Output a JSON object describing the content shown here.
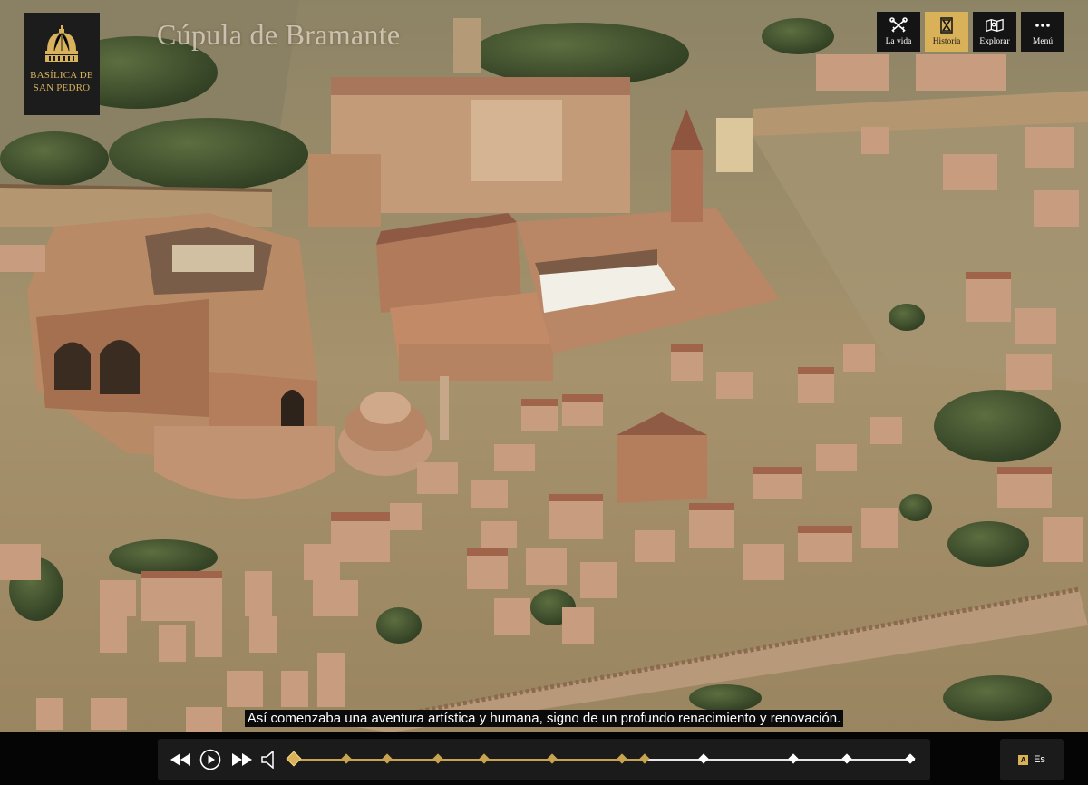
{
  "logo": {
    "line1": "BASÍLICA DE",
    "line2": "SAN PEDRO"
  },
  "place_title": "Cúpula de Bramante",
  "nav": [
    {
      "id": "la-vida",
      "label": "La vida",
      "icon": "crossed-keys-icon",
      "active": false
    },
    {
      "id": "historia",
      "label": "Historia",
      "icon": "hourglass-icon",
      "active": true
    },
    {
      "id": "explorar",
      "label": "Explorar",
      "icon": "map-icon",
      "active": false
    },
    {
      "id": "menu",
      "label": "Menú",
      "icon": "more-dots-icon",
      "active": false
    }
  ],
  "subtitle": "Así comenzaba una aventura artística y humana, signo de un profundo renacimiento y renovación.",
  "player": {
    "progress": 0.565,
    "markers": [
      0.0,
      0.084,
      0.15,
      0.232,
      0.307,
      0.416,
      0.528,
      0.565,
      0.66,
      0.805,
      0.89,
      0.992
    ],
    "current_marker": 0
  },
  "language": {
    "icon_label": "A",
    "code": "Es"
  },
  "colors": {
    "accent": "#d9b158",
    "bar": "#1b1b1b",
    "played": "#c9a450"
  }
}
